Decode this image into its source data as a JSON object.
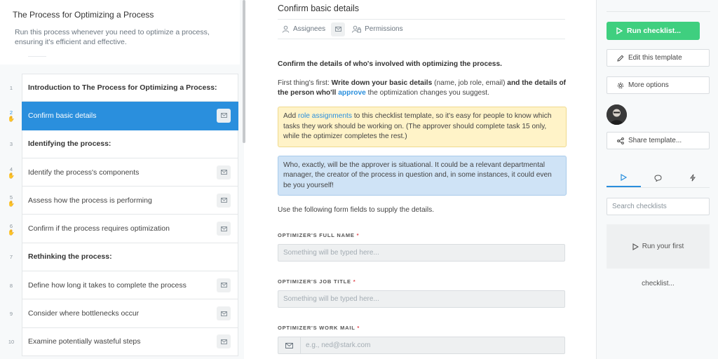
{
  "template": {
    "title": "The Process for Optimizing a Process",
    "description": "Run this process whenever you need to optimize a process, ensuring it's efficient and effective."
  },
  "tasks": [
    {
      "num": "1",
      "label": "Introduction to The Process for Optimizing a Process:",
      "heading": true
    },
    {
      "num": "2",
      "label": "Confirm basic details",
      "active": true
    },
    {
      "num": "3",
      "label": "Identifying the process:",
      "heading": true
    },
    {
      "num": "4",
      "label": "Identify the process's components"
    },
    {
      "num": "5",
      "label": "Assess how the process is performing"
    },
    {
      "num": "6",
      "label": "Confirm if the process requires optimization"
    },
    {
      "num": "7",
      "label": "Rethinking the process:",
      "heading": true
    },
    {
      "num": "8",
      "label": "Define how long it takes to complete the process"
    },
    {
      "num": "9",
      "label": "Consider where bottlenecks occur"
    },
    {
      "num": "10",
      "label": "Examine potentially wasteful steps"
    }
  ],
  "step": {
    "title": "Confirm basic details",
    "tabs": {
      "assignees": "Assignees",
      "permissions": "Permissions"
    },
    "lead": "Confirm the details of who's involved with optimizing the process.",
    "p1": {
      "a": "First thing's first: ",
      "b": "Write down your basic details",
      "c": " (name, job role, email) ",
      "d": "and the details of the person who'll ",
      "e": "approve",
      "f": " the optimization changes you suggest."
    },
    "yellow": {
      "a": "Add ",
      "link": "role assignments",
      "b": " to this checklist template, so it's easy for people to know which tasks they work should be working on. (The approver should complete task 15 only, while the optimizer completes the rest.)"
    },
    "blue": "Who, exactly, will be the approver is situational. It could be a relevant departmental manager, the creator of the process in question and, in some instances, it could even be you yourself!",
    "fields_intro": "Use the following form fields to supply the details.",
    "fields": [
      {
        "label": "OPTIMIZER'S FULL NAME",
        "placeholder": "Something will be typed here..."
      },
      {
        "label": "OPTIMIZER'S JOB TITLE",
        "placeholder": "Something will be typed here..."
      },
      {
        "label": "OPTIMIZER'S WORK MAIL",
        "placeholder": "e.g., ned@stark.com"
      }
    ],
    "required_mark": "*"
  },
  "right": {
    "run": "Run checklist...",
    "edit": "Edit this template",
    "more": "More options",
    "share": "Share template...",
    "search_placeholder": "Search checklists",
    "empty_a": "Run your first",
    "empty_b": "checklist..."
  },
  "colors": {
    "accent": "#2a8fdd",
    "run": "#3fcf7f",
    "callout_yellow": "#fff3c8",
    "callout_blue": "#cfe3f6"
  }
}
